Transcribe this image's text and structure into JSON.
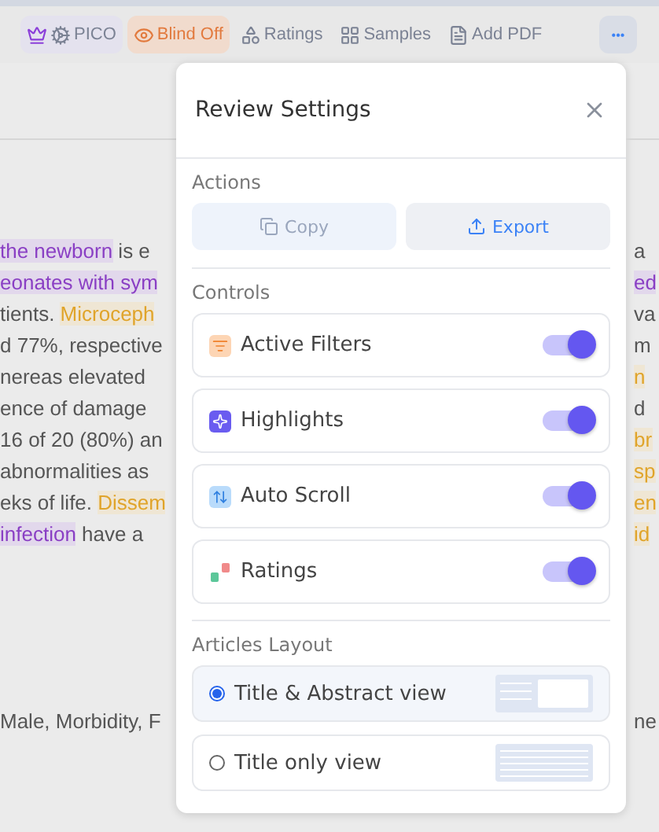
{
  "toolbar": {
    "items": [
      {
        "label": "PICO",
        "kind": "pico"
      },
      {
        "label": "Blind Off",
        "kind": "blind"
      },
      {
        "label": "Ratings",
        "kind": "plain"
      },
      {
        "label": "Samples",
        "kind": "plain"
      },
      {
        "label": "Add PDF",
        "kind": "plain"
      }
    ],
    "more": "•••"
  },
  "document": {
    "left_lines": [
      [
        {
          "text": "the newborn",
          "kind": "purple"
        },
        {
          "text": " is e",
          "kind": "plain"
        }
      ],
      [
        {
          "text": "eonates with sym",
          "kind": "purple"
        }
      ],
      [
        {
          "text": "tients. ",
          "kind": "plain"
        },
        {
          "text": "Microceph",
          "kind": "orange"
        }
      ],
      [
        {
          "text": "d 77%, respective",
          "kind": "plain"
        }
      ],
      [
        {
          "text": "nereas elevated ",
          "kind": "plain"
        }
      ],
      [
        {
          "text": "ence of damage",
          "kind": "plain"
        }
      ],
      [
        {
          "text": "16 of 20 (80%) an",
          "kind": "plain"
        }
      ],
      [
        {
          "text": "abnormalities as",
          "kind": "plain"
        }
      ],
      [
        {
          "text": "eks of life. ",
          "kind": "plain"
        },
        {
          "text": "Dissem",
          "kind": "orange"
        }
      ],
      [
        {
          "text": "infection",
          "kind": "purple"
        },
        {
          "text": " have a",
          "kind": "plain"
        }
      ]
    ],
    "left_keywords": "Male, Morbidity, F",
    "right_lines": [
      [
        {
          "text": "a",
          "kind": "plain"
        }
      ],
      [
        {
          "text": "ed",
          "kind": "purple"
        }
      ],
      [
        {
          "text": "va",
          "kind": "plain"
        }
      ],
      [
        {
          "text": "m",
          "kind": "plain"
        }
      ],
      [
        {
          "text": "n",
          "kind": "orange"
        }
      ],
      [
        {
          "text": "d",
          "kind": "plain"
        }
      ],
      [
        {
          "text": "br",
          "kind": "orange"
        }
      ],
      [
        {
          "text": "sp",
          "kind": "orange"
        }
      ],
      [
        {
          "text": "en",
          "kind": "orange"
        }
      ],
      [
        {
          "text": "id",
          "kind": "orange"
        }
      ]
    ],
    "right_keywords": "ne"
  },
  "panel": {
    "title": "Review Settings",
    "actions": {
      "heading": "Actions",
      "buttons": [
        {
          "label": "Copy",
          "disabled": true
        },
        {
          "label": "Export",
          "disabled": false
        }
      ]
    },
    "controls": {
      "heading": "Controls",
      "items": [
        {
          "label": "Active Filters",
          "on": true
        },
        {
          "label": "Highlights",
          "on": true
        },
        {
          "label": "Auto Scroll",
          "on": true
        },
        {
          "label": "Ratings",
          "on": true
        }
      ]
    },
    "layout": {
      "heading": "Articles Layout",
      "options": [
        {
          "label": "Title & Abstract view",
          "selected": true,
          "kind": "abstract"
        },
        {
          "label": "Title only view",
          "selected": false,
          "kind": "title"
        }
      ]
    }
  }
}
